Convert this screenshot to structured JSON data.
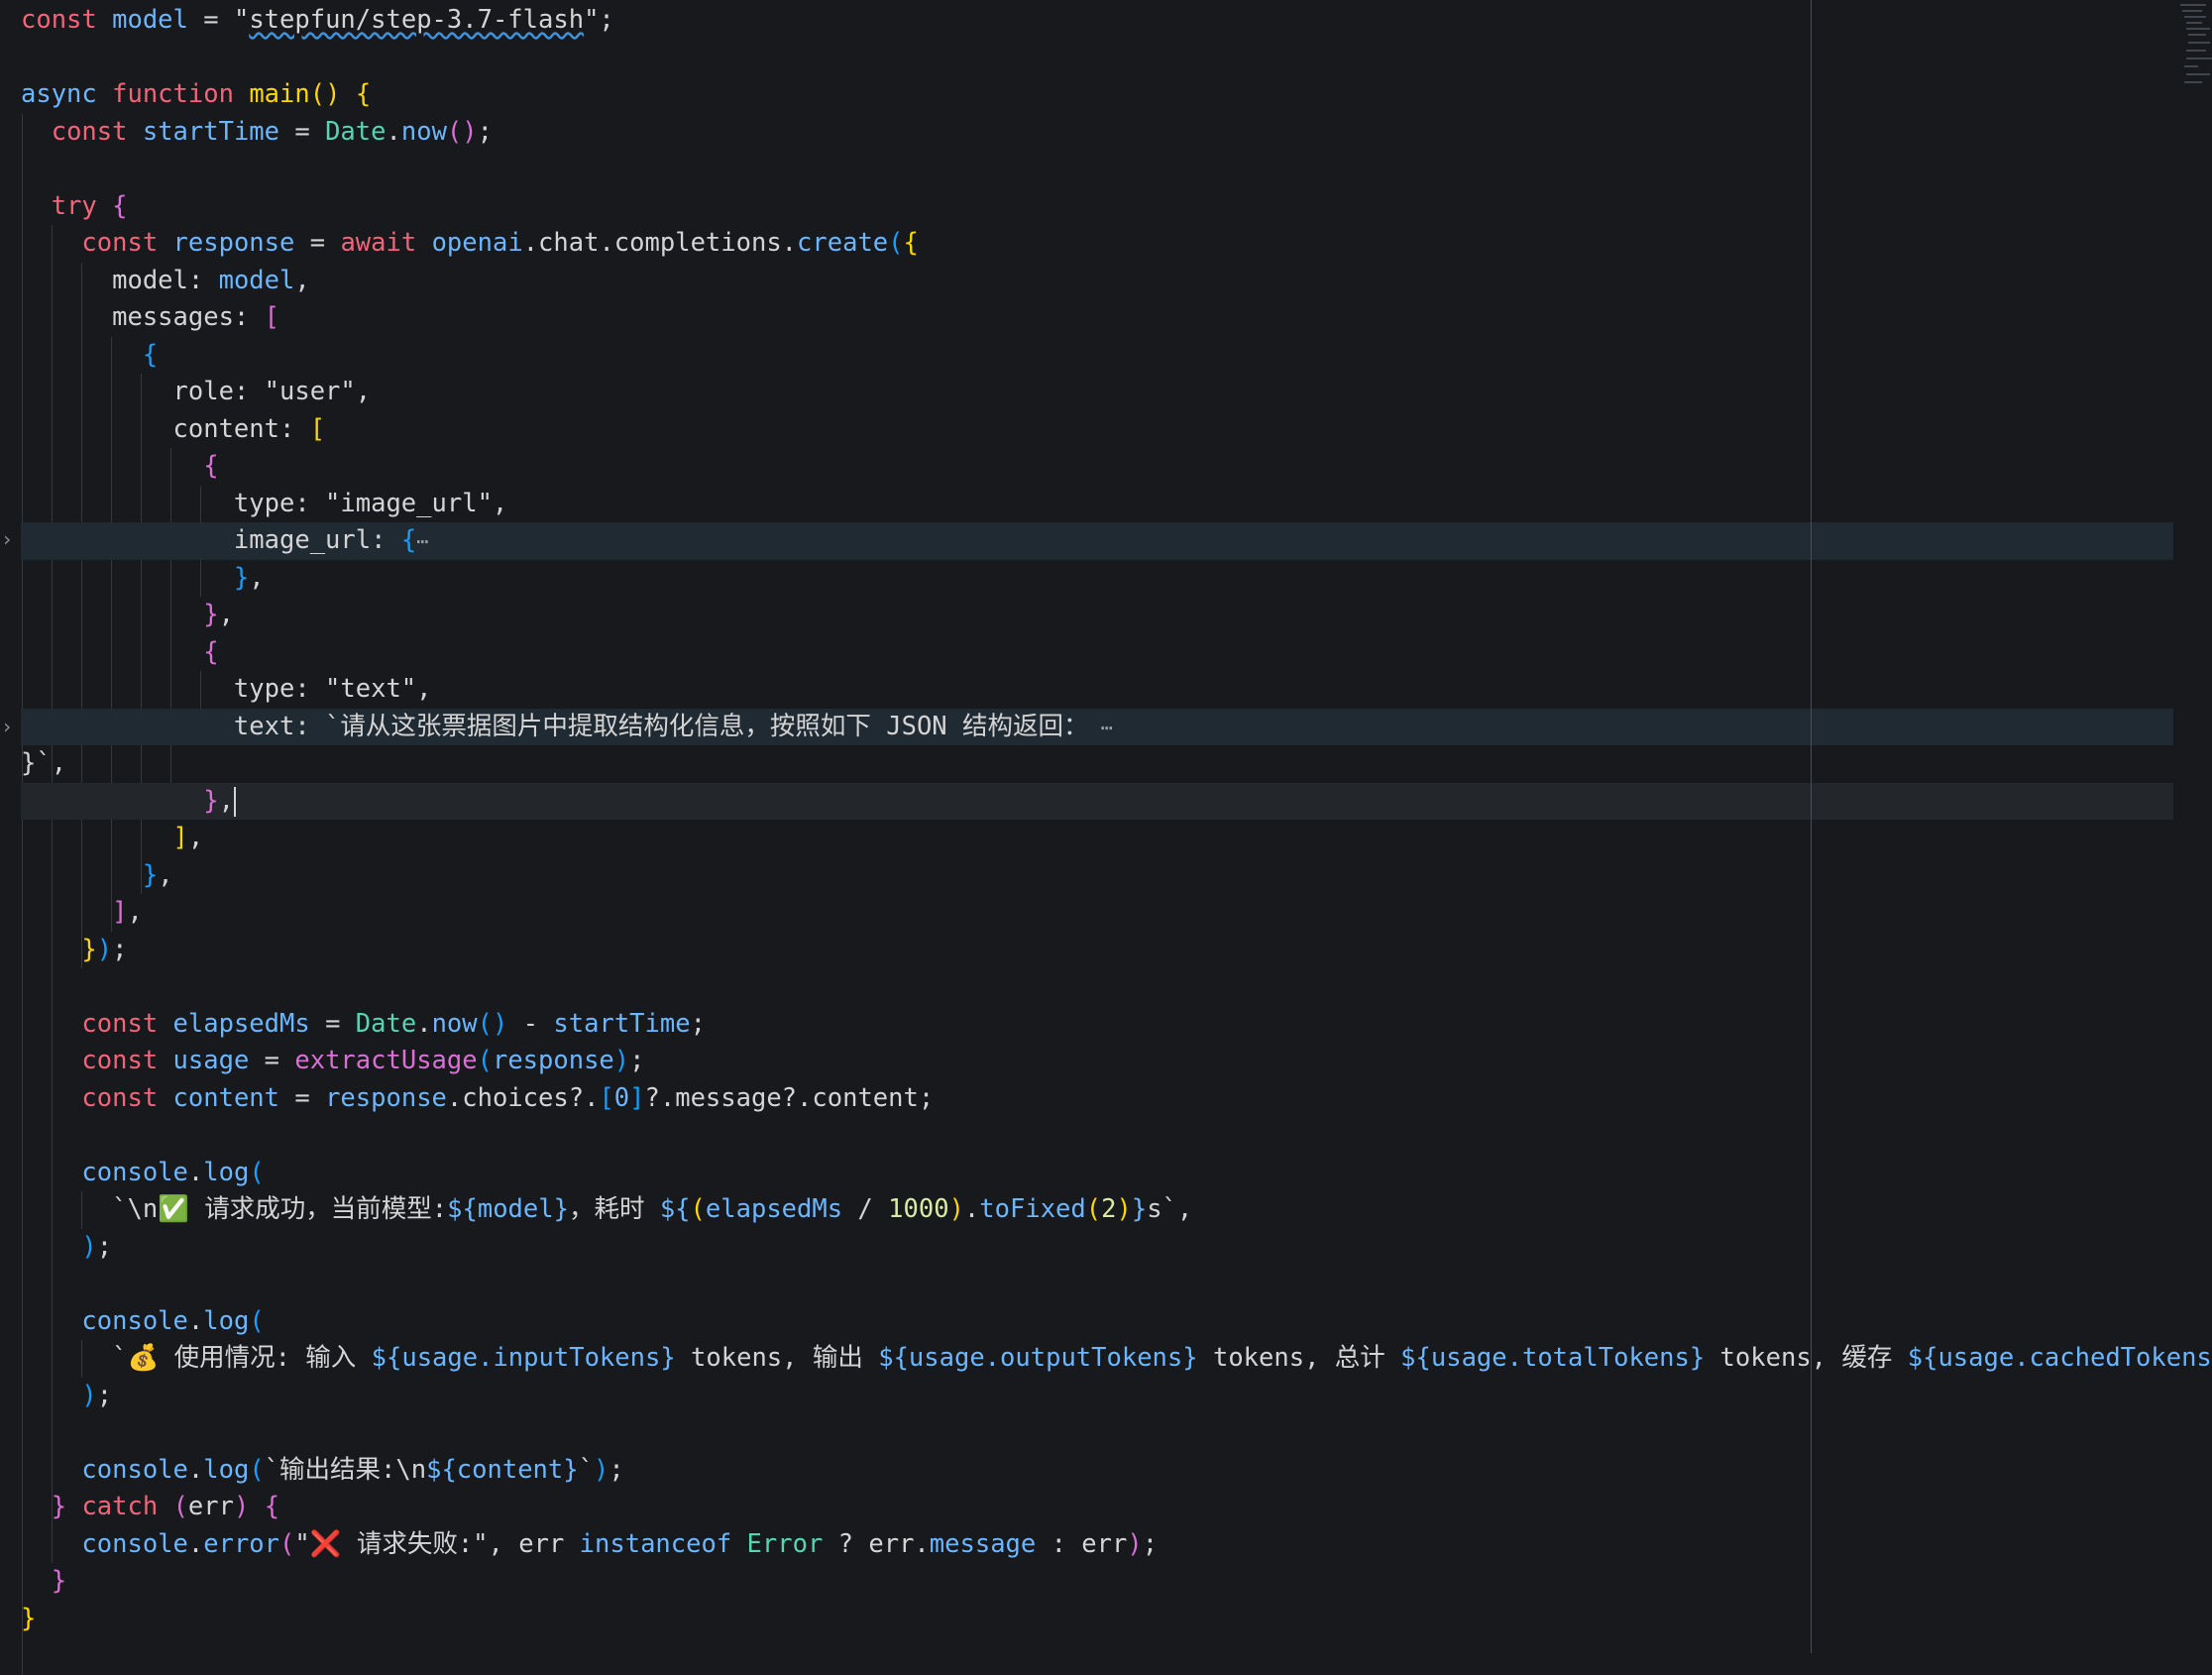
{
  "editor": {
    "lines": [
      [
        [
          "k",
          "const"
        ],
        [
          "w",
          " "
        ],
        [
          "b",
          "model"
        ],
        [
          "w",
          " = \""
        ],
        [
          "w",
          "stepfun/step-3.7-flash",
          "sq"
        ],
        [
          "w",
          "\";"
        ]
      ],
      [],
      [
        [
          "b",
          "async"
        ],
        [
          "w",
          " "
        ],
        [
          "k",
          "function"
        ],
        [
          "w",
          " "
        ],
        [
          "y",
          "main"
        ],
        [
          "y",
          "()"
        ],
        [
          "w",
          " "
        ],
        [
          "y",
          "{"
        ]
      ],
      [
        [
          "w",
          "  "
        ],
        [
          "k",
          "const"
        ],
        [
          "w",
          " "
        ],
        [
          "b",
          "startTime"
        ],
        [
          "w",
          " = "
        ],
        [
          "g",
          "Date"
        ],
        [
          "w",
          "."
        ],
        [
          "b",
          "now"
        ],
        [
          "p",
          "()"
        ],
        [
          "w",
          ";"
        ]
      ],
      [],
      [
        [
          "w",
          "  "
        ],
        [
          "k",
          "try"
        ],
        [
          "w",
          " "
        ],
        [
          "p",
          "{"
        ]
      ],
      [
        [
          "w",
          "    "
        ],
        [
          "k",
          "const"
        ],
        [
          "w",
          " "
        ],
        [
          "b",
          "response"
        ],
        [
          "w",
          " = "
        ],
        [
          "k",
          "await"
        ],
        [
          "w",
          " "
        ],
        [
          "b",
          "openai"
        ],
        [
          "w",
          ".chat.completions."
        ],
        [
          "b",
          "create"
        ],
        [
          "bl",
          "("
        ],
        [
          "y",
          "{"
        ]
      ],
      [
        [
          "w",
          "      model: "
        ],
        [
          "b",
          "model"
        ],
        [
          "w",
          ","
        ]
      ],
      [
        [
          "w",
          "      messages: "
        ],
        [
          "p",
          "["
        ]
      ],
      [
        [
          "w",
          "        "
        ],
        [
          "bl",
          "{"
        ]
      ],
      [
        [
          "w",
          "          role: \"user\","
        ]
      ],
      [
        [
          "w",
          "          content: "
        ],
        [
          "y",
          "["
        ]
      ],
      [
        [
          "w",
          "            "
        ],
        [
          "p",
          "{"
        ]
      ],
      [
        [
          "w",
          "              type: \"image_url\","
        ]
      ],
      [
        [
          "w",
          "              image_url: "
        ],
        [
          "bl",
          "{"
        ],
        [
          "ell",
          "⋯"
        ]
      ],
      [
        [
          "w",
          "              "
        ],
        [
          "bl",
          "}"
        ],
        [
          "w",
          ","
        ]
      ],
      [
        [
          "w",
          "            "
        ],
        [
          "p",
          "}"
        ],
        [
          "w",
          ","
        ]
      ],
      [
        [
          "w",
          "            "
        ],
        [
          "p",
          "{"
        ]
      ],
      [
        [
          "w",
          "              type: \"text\","
        ]
      ],
      [
        [
          "w",
          "              text: `请从这张票据图片中提取结构化信息，按照如下 JSON 结构返回："
        ],
        [
          "ell",
          " ⋯"
        ]
      ],
      [
        [
          "w",
          "}`,"
        ]
      ],
      [
        [
          "w",
          "            "
        ],
        [
          "p",
          "}"
        ],
        [
          "w",
          ","
        ]
      ],
      [
        [
          "w",
          "          "
        ],
        [
          "y",
          "]"
        ],
        [
          "w",
          ","
        ]
      ],
      [
        [
          "w",
          "        "
        ],
        [
          "bl",
          "}"
        ],
        [
          "w",
          ","
        ]
      ],
      [
        [
          "w",
          "      "
        ],
        [
          "p",
          "]"
        ],
        [
          "w",
          ","
        ]
      ],
      [
        [
          "w",
          "    "
        ],
        [
          "y",
          "}"
        ],
        [
          "bl",
          ")"
        ],
        [
          "w",
          ";"
        ]
      ],
      [],
      [
        [
          "w",
          "    "
        ],
        [
          "k",
          "const"
        ],
        [
          "w",
          " "
        ],
        [
          "b",
          "elapsedMs"
        ],
        [
          "w",
          " = "
        ],
        [
          "g",
          "Date"
        ],
        [
          "w",
          "."
        ],
        [
          "b",
          "now"
        ],
        [
          "bl",
          "()"
        ],
        [
          "w",
          " - "
        ],
        [
          "b",
          "startTime"
        ],
        [
          "w",
          ";"
        ]
      ],
      [
        [
          "w",
          "    "
        ],
        [
          "k",
          "const"
        ],
        [
          "w",
          " "
        ],
        [
          "b",
          "usage"
        ],
        [
          "w",
          " = "
        ],
        [
          "p",
          "extractUsage"
        ],
        [
          "bl",
          "("
        ],
        [
          "b",
          "response"
        ],
        [
          "bl",
          ")"
        ],
        [
          "w",
          ";"
        ]
      ],
      [
        [
          "w",
          "    "
        ],
        [
          "k",
          "const"
        ],
        [
          "w",
          " "
        ],
        [
          "b",
          "content"
        ],
        [
          "w",
          " = "
        ],
        [
          "b",
          "response"
        ],
        [
          "w",
          ".choices?."
        ],
        [
          "bl",
          "["
        ],
        [
          "b",
          "0"
        ],
        [
          "bl",
          "]"
        ],
        [
          "w",
          "?.message?.content;"
        ]
      ],
      [],
      [
        [
          "w",
          "    "
        ],
        [
          "b",
          "console"
        ],
        [
          "w",
          "."
        ],
        [
          "b",
          "log"
        ],
        [
          "bl",
          "("
        ]
      ],
      [
        [
          "w",
          "      `\\n✅ 请求成功，当前模型:"
        ],
        [
          "b",
          "${model}"
        ],
        [
          "w",
          "，耗时 "
        ],
        [
          "b",
          "${"
        ],
        [
          "y",
          "("
        ],
        [
          "b",
          "elapsedMs"
        ],
        [
          "w",
          " / "
        ],
        [
          "num",
          "1000"
        ],
        [
          "y",
          ")"
        ],
        [
          "w",
          "."
        ],
        [
          "b",
          "toFixed"
        ],
        [
          "y",
          "("
        ],
        [
          "num",
          "2"
        ],
        [
          "y",
          ")"
        ],
        [
          "b",
          "}"
        ],
        [
          "w",
          "s`,"
        ]
      ],
      [
        [
          "w",
          "    "
        ],
        [
          "bl",
          ")"
        ],
        [
          "w",
          ";"
        ]
      ],
      [],
      [
        [
          "w",
          "    "
        ],
        [
          "b",
          "console"
        ],
        [
          "w",
          "."
        ],
        [
          "b",
          "log"
        ],
        [
          "bl",
          "("
        ]
      ],
      [
        [
          "w",
          "      `💰 使用情况: 输入 "
        ],
        [
          "b",
          "${usage.inputTokens}"
        ],
        [
          "w",
          " tokens, 输出 "
        ],
        [
          "b",
          "${usage.outputTokens}"
        ],
        [
          "w",
          " tokens, 总计 "
        ],
        [
          "b",
          "${usage.totalTokens}"
        ],
        [
          "w",
          " tokens, 缓存 "
        ],
        [
          "b",
          "${usage.cachedTokens}"
        ]
      ],
      [
        [
          "w",
          "    "
        ],
        [
          "bl",
          ")"
        ],
        [
          "w",
          ";"
        ]
      ],
      [],
      [
        [
          "w",
          "    "
        ],
        [
          "b",
          "console"
        ],
        [
          "w",
          "."
        ],
        [
          "b",
          "log"
        ],
        [
          "bl",
          "("
        ],
        [
          "w",
          "`输出结果:\\n"
        ],
        [
          "b",
          "${content}"
        ],
        [
          "w",
          "`"
        ],
        [
          "bl",
          ")"
        ],
        [
          "w",
          ";"
        ]
      ],
      [
        [
          "w",
          "  "
        ],
        [
          "p",
          "}"
        ],
        [
          "w",
          " "
        ],
        [
          "k",
          "catch"
        ],
        [
          "w",
          " "
        ],
        [
          "p",
          "("
        ],
        [
          "w",
          "err"
        ],
        [
          "p",
          ")"
        ],
        [
          "w",
          " "
        ],
        [
          "p",
          "{"
        ]
      ],
      [
        [
          "w",
          "    "
        ],
        [
          "b",
          "console"
        ],
        [
          "w",
          "."
        ],
        [
          "b",
          "error"
        ],
        [
          "p",
          "("
        ],
        [
          "w",
          "\"❌ 请求失败:\", err "
        ],
        [
          "b",
          "instanceof"
        ],
        [
          "w",
          " "
        ],
        [
          "g",
          "Error"
        ],
        [
          "w",
          " ? err."
        ],
        [
          "b",
          "message"
        ],
        [
          "w",
          " : err"
        ],
        [
          "p",
          ")"
        ],
        [
          "w",
          ";"
        ]
      ],
      [
        [
          "w",
          "  "
        ],
        [
          "p",
          "}"
        ]
      ],
      [
        [
          "y",
          "}"
        ]
      ]
    ]
  }
}
